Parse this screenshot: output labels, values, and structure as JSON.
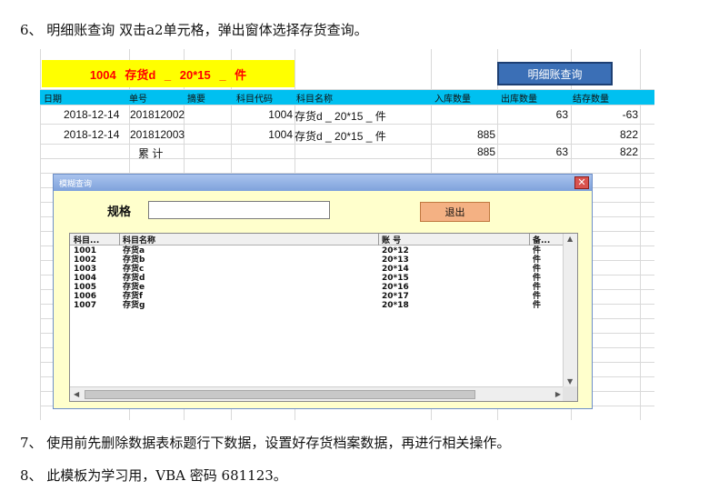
{
  "instructions": {
    "step6": "6、 明细账查询    双击a2单元格，弹出窗体选择存货查询。",
    "step7": "7、 使用前先删除数据表标题行下数据，设置好存货档案数据，再进行相关操作。",
    "step8": "8、 此模板为学习用，VBA 密码 681123。"
  },
  "sheet": {
    "banner": "1004 存货d  _  20*15  _  件",
    "query_button": "明细账查询",
    "headers": {
      "date": "日期",
      "doc_no": "单号",
      "summary": "摘要",
      "code": "科目代码",
      "name": "科目名称",
      "in_qty": "入库数量",
      "out_qty": "出库数量",
      "balance": "结存数量"
    },
    "rows": [
      {
        "date": "2018-12-14",
        "doc_no": "201812002",
        "code": "1004",
        "name": "存货d  _  20*15  _  件",
        "in_qty": "",
        "out_qty": "63",
        "balance": "-63"
      },
      {
        "date": "2018-12-14",
        "doc_no": "201812003",
        "code": "1004",
        "name": "存货d  _  20*15  _  件",
        "in_qty": "885",
        "out_qty": "",
        "balance": "822"
      }
    ],
    "total": {
      "label": "累    计",
      "in_qty": "885",
      "out_qty": "63",
      "balance": "822"
    }
  },
  "dialog": {
    "title": "模糊查询",
    "close_glyph": "✕",
    "spec_label": "规格",
    "spec_value": "",
    "exit_button": "退出",
    "columns": [
      "科目...",
      "科目名称",
      "账    号",
      "备..."
    ],
    "items": [
      {
        "code": "1001",
        "name": "存货a",
        "account": "20*12",
        "unit": "件"
      },
      {
        "code": "1002",
        "name": "存货b",
        "account": "20*13",
        "unit": "件"
      },
      {
        "code": "1003",
        "name": "存货c",
        "account": "20*14",
        "unit": "件"
      },
      {
        "code": "1004",
        "name": "存货d",
        "account": "20*15",
        "unit": "件"
      },
      {
        "code": "1005",
        "name": "存货e",
        "account": "20*16",
        "unit": "件"
      },
      {
        "code": "1006",
        "name": "存货f",
        "account": "20*17",
        "unit": "件"
      },
      {
        "code": "1007",
        "name": "存货g",
        "account": "20*18",
        "unit": "件"
      }
    ]
  },
  "colors": {
    "banner_bg": "#ffff00",
    "banner_text": "#ff0000",
    "header_bg": "#00c0f0",
    "dialog_bg": "#ffffcc",
    "exit_bg": "#f4b183",
    "query_bg": "#3b6fb6"
  },
  "icons": {
    "close": "close-icon",
    "scroll_left": "scroll-left-arrow-icon",
    "scroll_right": "scroll-right-arrow-icon",
    "scroll_up": "scroll-up-arrow-icon",
    "scroll_down": "scroll-down-arrow-icon"
  }
}
